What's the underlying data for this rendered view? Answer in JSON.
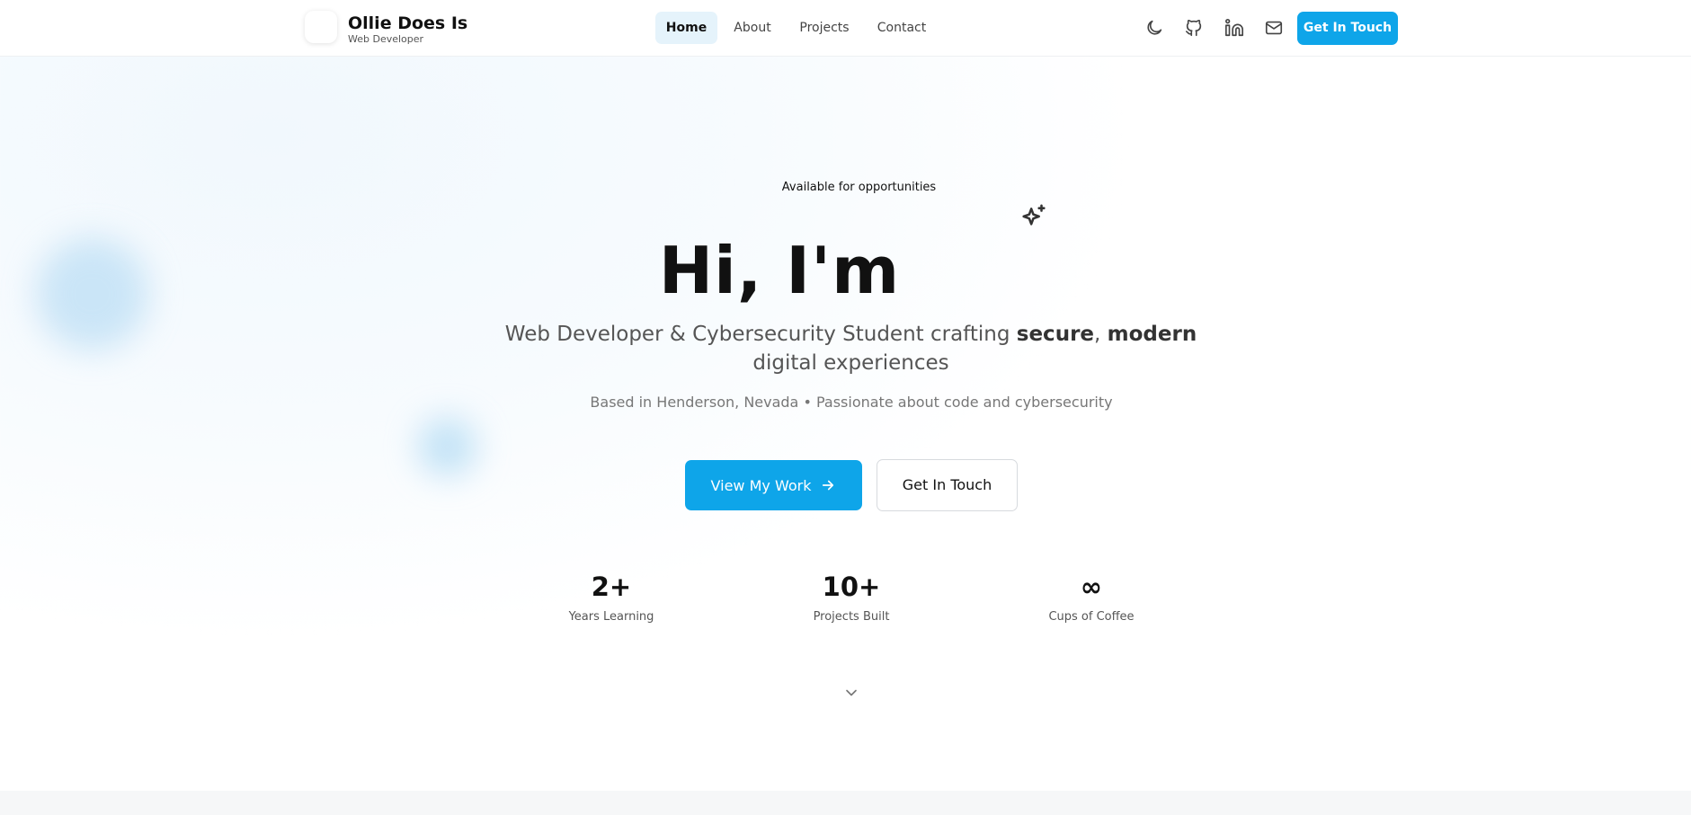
{
  "header": {
    "brand_name": "Ollie Does Is",
    "brand_subtitle": "Web Developer",
    "nav": [
      {
        "label": "Home",
        "active": true
      },
      {
        "label": "About"
      },
      {
        "label": "Projects"
      },
      {
        "label": "Contact"
      }
    ],
    "icons": [
      "moon-icon",
      "github-icon",
      "linkedin-icon",
      "mail-icon"
    ],
    "cta_label": "Get In Touch"
  },
  "hero": {
    "availability": "Available for opportunities",
    "title": "Hi, I'm",
    "subtitle_prefix": "Web Developer & Cybersecurity Student crafting ",
    "subtitle_bold_1": "secure",
    "subtitle_sep": ", ",
    "subtitle_bold_2": "modern",
    "subtitle_suffix": " digital experiences",
    "location": "Based in Henderson, Nevada • Passionate about code and cybersecurity",
    "primary_button": "View My Work",
    "secondary_button": "Get In Touch"
  },
  "stats": [
    {
      "value": "2+",
      "label": "Years Learning"
    },
    {
      "value": "10+",
      "label": "Projects Built"
    },
    {
      "value": "∞",
      "label": "Cups of Coffee"
    }
  ],
  "colors": {
    "accent": "#0ea5e9",
    "nav_active_bg": "#e5f3fb",
    "text_primary": "#111111",
    "text_muted": "#555555"
  }
}
